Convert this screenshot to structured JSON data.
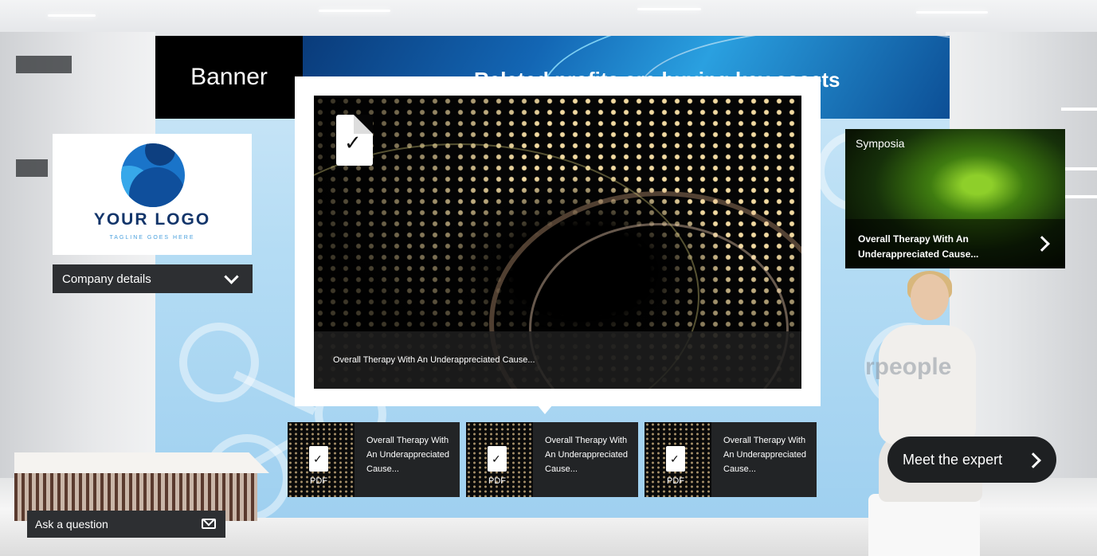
{
  "banner": {
    "label": "Banner",
    "headline": "Related profits are buying key assets"
  },
  "logo": {
    "text": "YOUR LOGO",
    "tagline": "TAGLINE GOES HERE"
  },
  "company_details": {
    "label": "Company details"
  },
  "featured": {
    "caption": "Overall Therapy With An Underappreciated Cause..."
  },
  "thumbnails": [
    {
      "title": "Overall Therapy With An Underappreciated Cause...",
      "badge": "PDF"
    },
    {
      "title": "Overall Therapy With An Underappreciated Cause...",
      "badge": "PDF"
    },
    {
      "title": "Overall Therapy With An Underappreciated Cause...",
      "badge": "PDF"
    }
  ],
  "symposia": {
    "title": "Symposia",
    "caption": "Overall Therapy With An Underappreciated Cause..."
  },
  "expert": {
    "watermark": "rpeople",
    "button_label": "Meet the expert"
  },
  "ask": {
    "label": "Ask a question"
  },
  "colors": {
    "dark_button": "#2d2f32",
    "booth_blue": "#b4dcf4",
    "logo_blue": "#1a74c9"
  },
  "icons": [
    "pdf-icon",
    "chevron-down-icon",
    "chevron-right-icon",
    "mail-icon"
  ]
}
